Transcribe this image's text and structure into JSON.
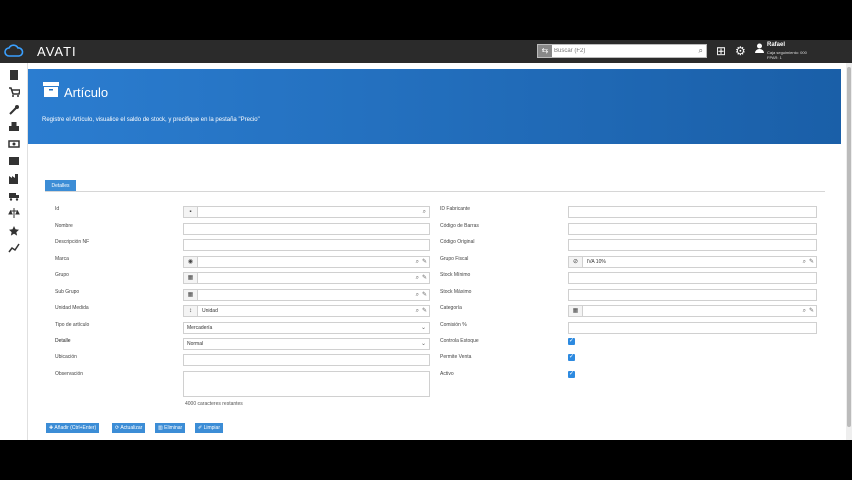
{
  "brand": "AVATI",
  "search": {
    "placeholder": "Buscar (F2)"
  },
  "user": {
    "name": "Rafael",
    "line1": "Caja seguimiento: 000",
    "line2": "FPAR: 1"
  },
  "header": {
    "title": "Artículo",
    "subtitle": "Registre el Artículo, visualice el saldo de stock, y precifique en la pestaña \"Precio\""
  },
  "tab": {
    "label": "Detalles"
  },
  "left_form": {
    "id_label": "Id",
    "nombre_label": "Nombre",
    "descnf_label": "Descripción NF",
    "marca_label": "Marca",
    "grupo_label": "Grupo",
    "subgrupo_label": "Sub Grupo",
    "unidad_label": "Unidad Medida",
    "unidad_value": "Unidad",
    "tipo_label": "Tipo de artículo",
    "tipo_value": "Mercadería",
    "detalle_label": "Detalle",
    "detalle_value": "Normal",
    "ubicacion_label": "Ubicación",
    "observacion_label": "Observación",
    "counter": "4000 caracteres restantes"
  },
  "right_form": {
    "fabricante_label": "ID Fabricante",
    "codbarras_label": "Código de Barras",
    "codoriginal_label": "Código Original",
    "grupofiscal_label": "Grupo Fiscal",
    "grupofiscal_value": "IVA 10%",
    "stockmin_label": "Stock Mínimo",
    "stockmax_label": "Stock Máximo",
    "categoria_label": "Categoría",
    "comision_label": "Comisión %",
    "controla_label": "Controla Estoque",
    "controla_checked": true,
    "permite_label": "Permite Venta",
    "permite_checked": true,
    "activo_label": "Activo",
    "activo_checked": true
  },
  "buttons": {
    "add": "Añadir (Ctrl+Enter)",
    "update": "Actualizar",
    "delete": "Eliminar",
    "clear": "Limpiar"
  },
  "colors": {
    "topbar": "#2b2b2b",
    "header": "#1f6dbb",
    "accent": "#3c8dd6"
  }
}
